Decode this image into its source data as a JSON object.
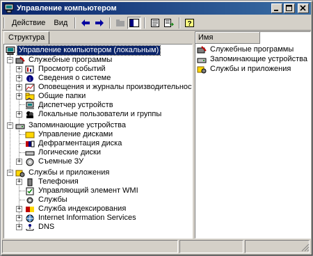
{
  "window": {
    "title": "Управление компьютером"
  },
  "menu": {
    "action": "Действие",
    "view": "Вид"
  },
  "toolbar": {
    "icons": [
      "back-arrow-icon",
      "forward-arrow-icon",
      "up-folder-icon",
      "show-hide-tree-icon",
      "properties-icon",
      "export-list-icon",
      "help-icon"
    ]
  },
  "tab": {
    "label": "Структура"
  },
  "right": {
    "column_name": "Имя",
    "items": [
      "Служебные программы",
      "Запоминающие устройства",
      "Службы и приложения"
    ]
  },
  "tree": {
    "root": "Управление компьютером (локальным)",
    "system_tools": "Служебные программы",
    "event_viewer": "Просмотр событий",
    "system_info": "Сведения о системе",
    "perf_logs": "Оповещения и журналы производительности",
    "shared_folders": "Общие папки",
    "device_manager": "Диспетчер устройств",
    "local_users": "Локальные пользователи и группы",
    "storage": "Запоминающие устройства",
    "disk_management": "Управление дисками",
    "defrag": "Дефрагментация диска",
    "logical_drives": "Логические диски",
    "removable": "Съемные ЗУ",
    "services_apps": "Службы и приложения",
    "telephony": "Телефония",
    "wmi": "Управляющий элемент WMI",
    "services": "Службы",
    "indexing": "Служба индексирования",
    "iis": "Internet Information Services",
    "dns": "DNS"
  },
  "colors": {
    "titlebar_start": "#0a246a",
    "titlebar_end": "#3a6ea5",
    "selection": "#0a246a",
    "face": "#d4d0c8"
  }
}
